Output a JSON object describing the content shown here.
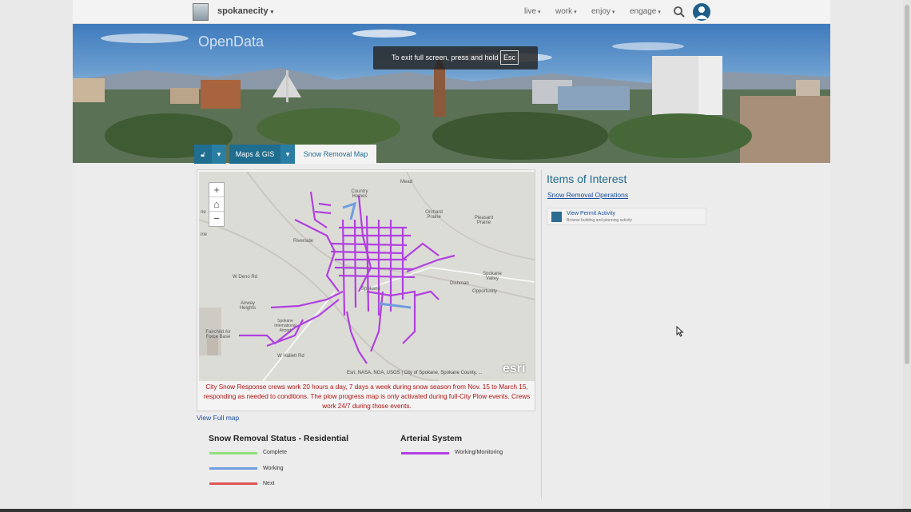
{
  "header": {
    "brand": "spokanecity",
    "nav": [
      "live",
      "work",
      "enjoy",
      "engage"
    ]
  },
  "hero": {
    "title": "OpenData"
  },
  "toast": {
    "text": "To exit full screen, press and hold",
    "key": "Esc"
  },
  "breadcrumb": {
    "items": [
      "Maps & GIS",
      "Snow Removal Map"
    ]
  },
  "map": {
    "labels": [
      "Mead",
      "Country Homes",
      "Orchard Prairie",
      "Pleasant Prairie",
      "Spokane Valley",
      "Opportunity",
      "Dishman",
      "W Deno Rd",
      "Airway Heights",
      "Fairchild Air Force Base",
      "Spokane International Airport",
      "W Hallett Rd",
      "Riverside",
      "Spokane",
      "rie",
      "irie"
    ],
    "attribution": "Esri, NASA, NGA, USGS | City of Spokane, Spokane County, ...",
    "esri": "esri",
    "caption": "City Snow Response crews work 20 hours a day, 7 days a week during snow season from Nov. 15 to March 15, responding as needed to conditions. The plow progress map is only activated during full-City Plow events. Crews work 24/7 during those events."
  },
  "view_full_map": "View Full map",
  "legend": {
    "residential_title": "Snow Removal Status - Residential",
    "residential": [
      {
        "label": "Complete",
        "color": "#8fe07a"
      },
      {
        "label": "Working",
        "color": "#6f9de0"
      },
      {
        "label": "Next",
        "color": "#e05555"
      }
    ],
    "arterial_title": "Arterial System",
    "arterial": [
      {
        "label": "Working/Monitoring",
        "color": "#b040e0"
      }
    ]
  },
  "items_of_interest": {
    "title": "Items of Interest",
    "link": "Snow Removal Operations",
    "permit_title": "View Permit Activity",
    "permit_sub": "Browse building and planning activity"
  },
  "colors": {
    "accent": "#1f6d8f",
    "arterial": "#b040e0",
    "caption_red": "#b11212"
  }
}
